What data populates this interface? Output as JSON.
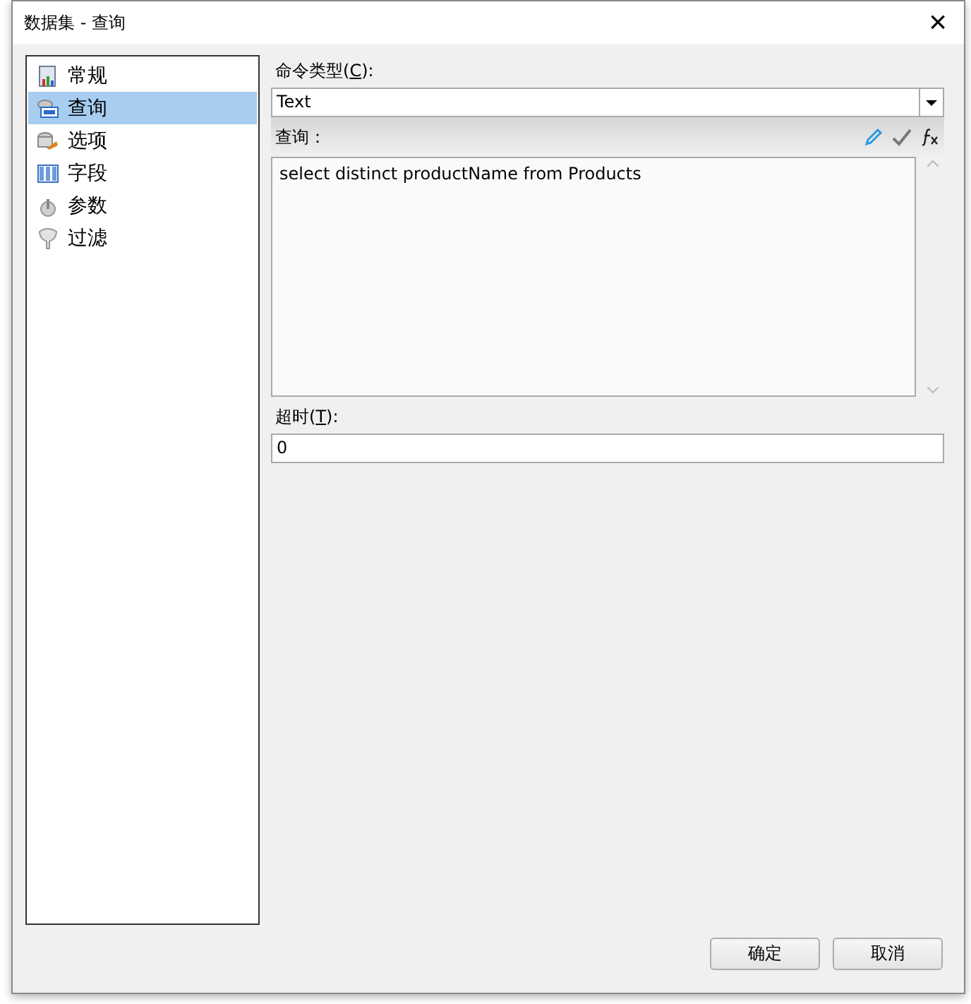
{
  "window": {
    "title": "数据集 - 查询",
    "close": "×"
  },
  "sidebar": {
    "items": [
      {
        "label": "常规",
        "kind": "report",
        "selected": false
      },
      {
        "label": "查询",
        "kind": "query",
        "selected": true
      },
      {
        "label": "选项",
        "kind": "options",
        "selected": false
      },
      {
        "label": "字段",
        "kind": "fields",
        "selected": false
      },
      {
        "label": "参数",
        "kind": "params",
        "selected": false
      },
      {
        "label": "过滤",
        "kind": "filter",
        "selected": false
      }
    ]
  },
  "command_type": {
    "label": {
      "prefix": "命令类型(",
      "access_key": "C",
      "suffix": "):"
    },
    "value": "Text"
  },
  "query": {
    "label": "查询：",
    "text": "select distinct productName from Products"
  },
  "timeout": {
    "label": {
      "prefix": "超时(",
      "access_key": "T",
      "suffix": "):"
    },
    "value": "0"
  },
  "buttons": [
    "确定",
    "取消"
  ]
}
